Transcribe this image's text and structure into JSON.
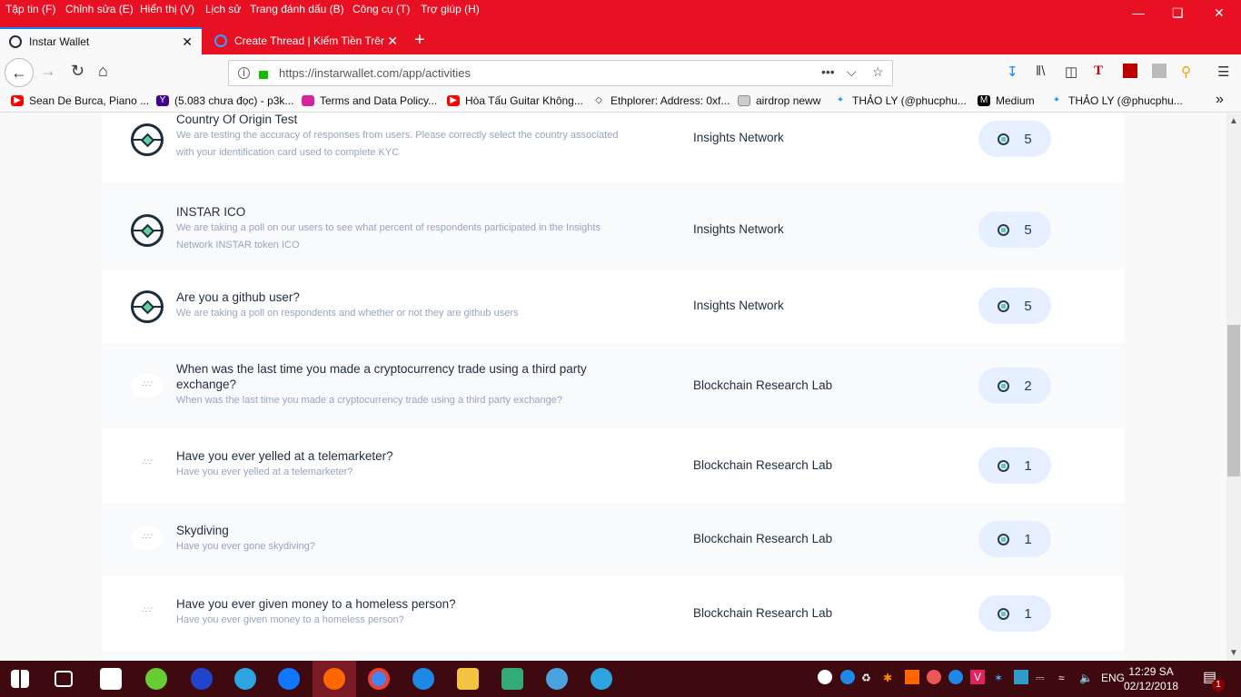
{
  "menu": [
    "Tập tin (F)",
    "Chỉnh sửa (E)",
    "Hiển thị (V)",
    "Lịch sử",
    "Trang đánh dấu (B)",
    "Công cụ (T)",
    "Trợ giúp (H)"
  ],
  "tabs": [
    {
      "title": "Instar Wallet"
    },
    {
      "title": "Create Thread | Kiếm Tiền Trên"
    }
  ],
  "url": "https://instarwallet.com/app/activities",
  "bookmarks": [
    "Sean De Burca, Piano ...",
    "(5.083 chưa đọc) - p3k...",
    "Terms and Data Policy...",
    "Hòa Tấu Guitar Không...",
    "Ethplorer: Address: 0xf...",
    "airdrop neww",
    "THẢO LY (@phucphu...",
    "Medium",
    "THẢO LY (@phucphu..."
  ],
  "activities": [
    {
      "title": "Country Of Origin Test",
      "desc": "We are testing the accuracy of responses from users. Please correctly select the country associated with your identification card used to complete KYC",
      "org": "Insights Network",
      "reward": "5",
      "icon": "insights-logo"
    },
    {
      "title": "INSTAR ICO",
      "desc": "We are taking a poll on our users to see what percent of respondents participated in the Insights Network INSTAR token ICO",
      "org": "Insights Network",
      "reward": "5",
      "icon": "insights-logo"
    },
    {
      "title": "Are you a github user?",
      "desc": "We are taking a poll on respondents and whether or not they are github users",
      "org": "Insights Network",
      "reward": "5",
      "icon": "insights-logo"
    },
    {
      "title": "When was the last time you made a cryptocurrency trade using a third party exchange?",
      "desc": "When was the last time you made a cryptocurrency trade using a third party exchange?",
      "org": "Blockchain Research Lab",
      "reward": "2",
      "icon": "blockchain-research-lab-logo"
    },
    {
      "title": "Have you ever yelled at a telemarketer?",
      "desc": "Have you ever yelled at a telemarketer?",
      "org": "Blockchain Research Lab",
      "reward": "1",
      "icon": "blockchain-research-lab-logo"
    },
    {
      "title": "Skydiving",
      "desc": "Have you ever gone skydiving?",
      "org": "Blockchain Research Lab",
      "reward": "1",
      "icon": "blockchain-research-lab-logo"
    },
    {
      "title": "Have you ever given money to a homeless person?",
      "desc": "Have you ever given money to a homeless person?",
      "org": "Blockchain Research Lab",
      "reward": "1",
      "icon": "blockchain-research-lab-logo"
    }
  ],
  "tray": {
    "lang": "ENG",
    "time": "12:29 SA",
    "date": "02/12/2018",
    "notifications": "1"
  },
  "colors": {
    "accent": "#e81123",
    "pill": "#e6efff",
    "taskbar": "#3e0a10"
  }
}
